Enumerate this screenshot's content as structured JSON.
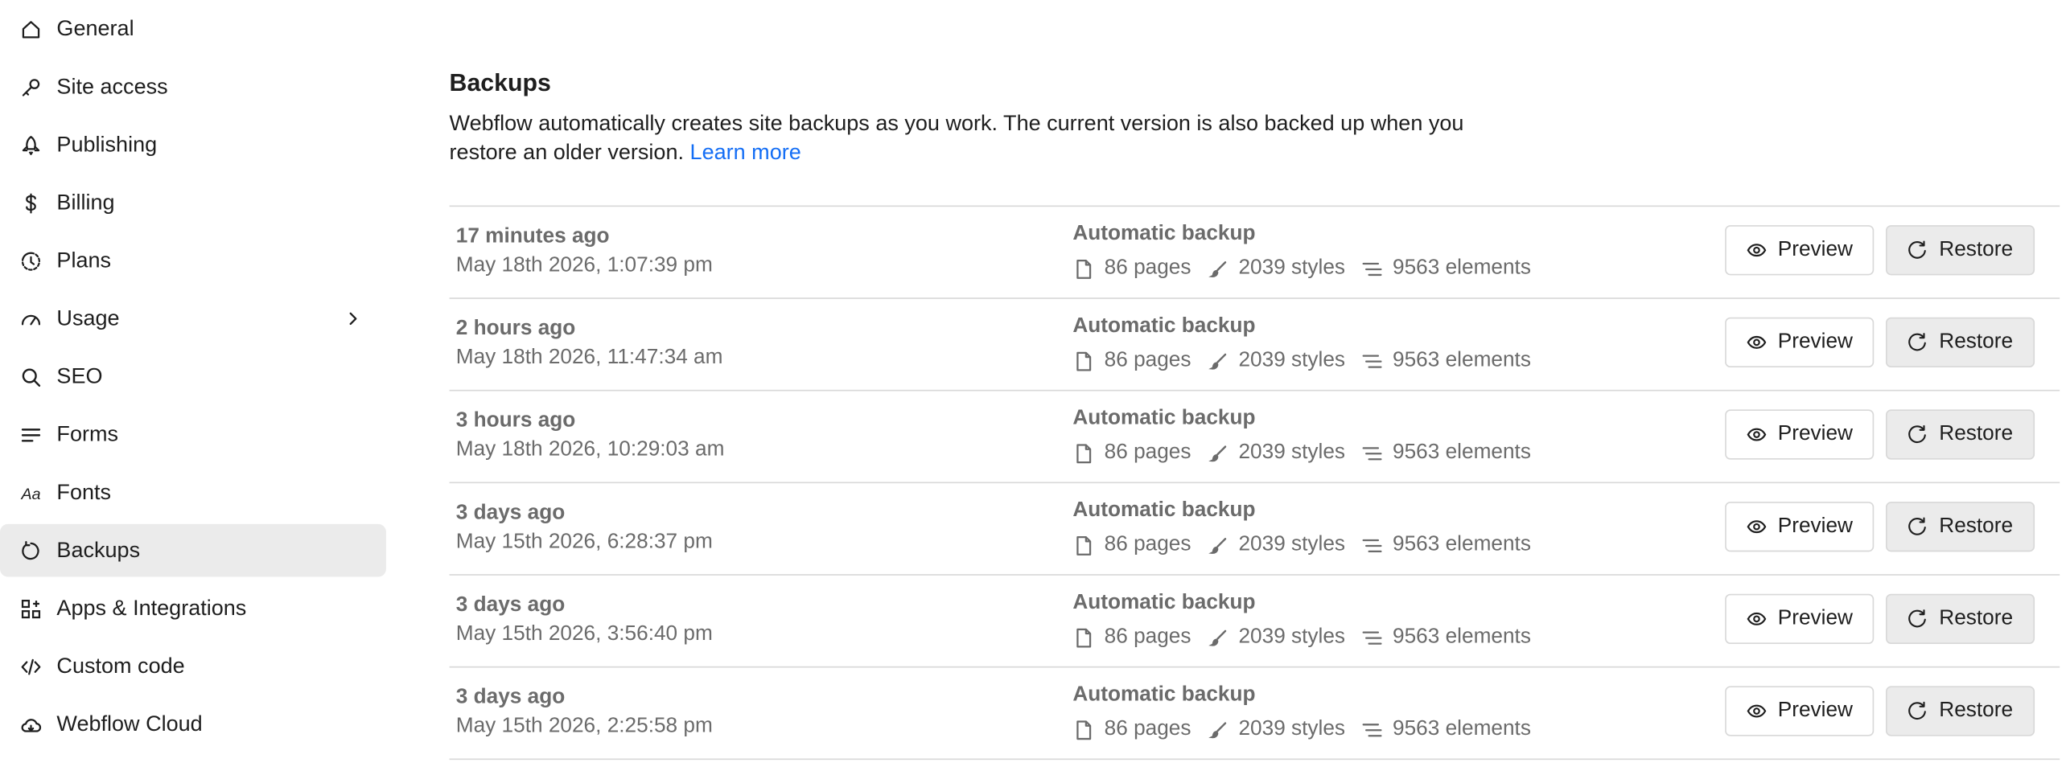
{
  "sidebar": {
    "items": [
      {
        "label": "General",
        "icon": "home-icon"
      },
      {
        "label": "Site access",
        "icon": "key-icon"
      },
      {
        "label": "Publishing",
        "icon": "rocket-icon"
      },
      {
        "label": "Billing",
        "icon": "dollar-icon"
      },
      {
        "label": "Plans",
        "icon": "plan-clock-icon"
      },
      {
        "label": "Usage",
        "icon": "gauge-icon"
      },
      {
        "label": "SEO",
        "icon": "search-icon"
      },
      {
        "label": "Forms",
        "icon": "lines-icon"
      },
      {
        "label": "Fonts",
        "icon": "font-aa-icon"
      },
      {
        "label": "Backups",
        "icon": "restore-icon"
      },
      {
        "label": "Apps & Integrations",
        "icon": "apps-grid-icon"
      },
      {
        "label": "Custom code",
        "icon": "code-icon"
      },
      {
        "label": "Webflow Cloud",
        "icon": "cloud-icon"
      }
    ],
    "active": "Backups",
    "expandable": "Usage",
    "font_aa_glyph": "Aa"
  },
  "main": {
    "title": "Backups",
    "description": "Webflow automatically creates site backups as you work. The current version is also backed up when you restore an older version.",
    "learn_more": "Learn more"
  },
  "backups": [
    {
      "relative": "17 minutes ago",
      "date": "May 18th 2026, 1:07:39 pm",
      "type": "Automatic backup",
      "pages": "86 pages",
      "styles": "2039 styles",
      "elements": "9563 elements"
    },
    {
      "relative": "2 hours ago",
      "date": "May 18th 2026, 11:47:34 am",
      "type": "Automatic backup",
      "pages": "86 pages",
      "styles": "2039 styles",
      "elements": "9563 elements"
    },
    {
      "relative": "3 hours ago",
      "date": "May 18th 2026, 10:29:03 am",
      "type": "Automatic backup",
      "pages": "86 pages",
      "styles": "2039 styles",
      "elements": "9563 elements"
    },
    {
      "relative": "3 days ago",
      "date": "May 15th 2026, 6:28:37 pm",
      "type": "Automatic backup",
      "pages": "86 pages",
      "styles": "2039 styles",
      "elements": "9563 elements"
    },
    {
      "relative": "3 days ago",
      "date": "May 15th 2026, 3:56:40 pm",
      "type": "Automatic backup",
      "pages": "86 pages",
      "styles": "2039 styles",
      "elements": "9563 elements"
    },
    {
      "relative": "3 days ago",
      "date": "May 15th 2026, 2:25:58 pm",
      "type": "Automatic backup",
      "pages": "86 pages",
      "styles": "2039 styles",
      "elements": "9563 elements"
    }
  ],
  "buttons": {
    "preview": "Preview",
    "restore": "Restore"
  },
  "colors": {
    "accent_link": "#146ef5",
    "active_bg": "#ebebeb",
    "muted_text": "#6b6b6b",
    "divider": "#d8d8d8"
  }
}
